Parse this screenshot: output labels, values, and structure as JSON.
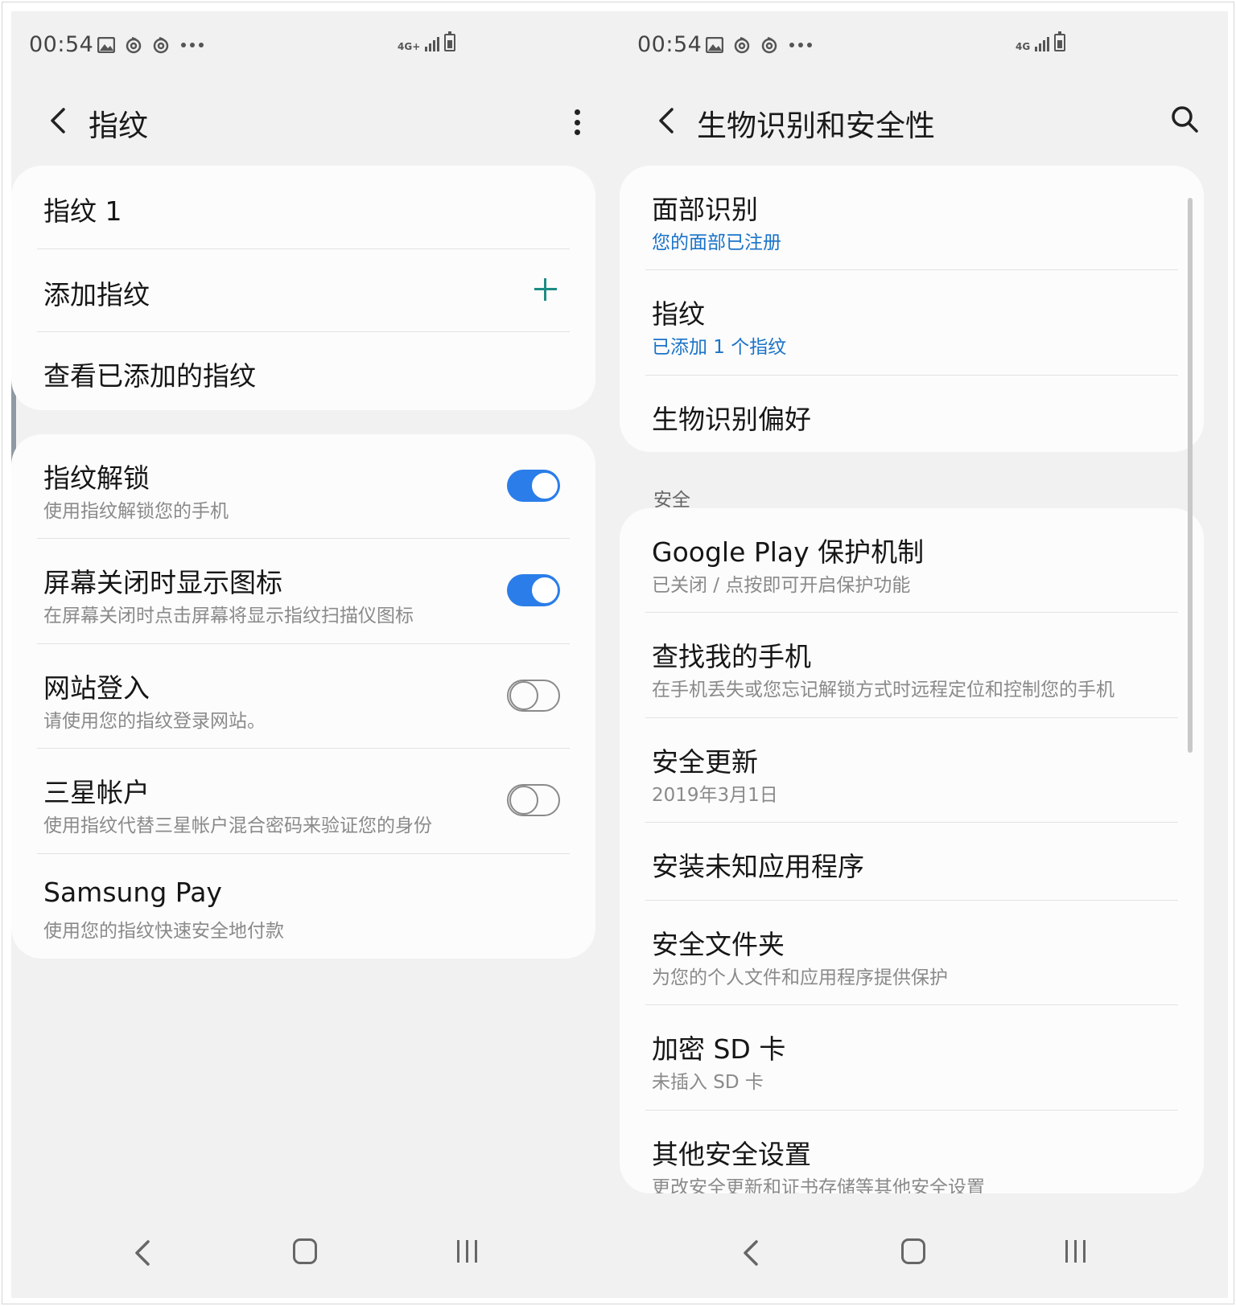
{
  "left": {
    "status": {
      "time": "00:54",
      "network": "4G+"
    },
    "appbar": {
      "title": "指纹"
    },
    "fingerprints_card": {
      "items": [
        {
          "label": "指纹 1"
        },
        {
          "label": "添加指纹"
        },
        {
          "label": "查看已添加的指纹"
        }
      ]
    },
    "options_card": {
      "items": [
        {
          "title": "指纹解锁",
          "subtitle": "使用指纹解锁您的手机",
          "toggle": "on"
        },
        {
          "title": "屏幕关闭时显示图标",
          "subtitle": "在屏幕关闭时点击屏幕将显示指纹扫描仪图标",
          "toggle": "on"
        },
        {
          "title": "网站登入",
          "subtitle": "请使用您的指纹登录网站。",
          "toggle": "off"
        },
        {
          "title": "三星帐户",
          "subtitle": "使用指纹代替三星帐户混合密码来验证您的身份",
          "toggle": "off"
        },
        {
          "title": "Samsung Pay",
          "subtitle": "使用您的指纹快速安全地付款"
        }
      ]
    }
  },
  "right": {
    "status": {
      "time": "00:54",
      "network": "4G"
    },
    "appbar": {
      "title": "生物识别和安全性"
    },
    "biometrics_card": {
      "items": [
        {
          "title": "面部识别",
          "subtitle": "您的面部已注册"
        },
        {
          "title": "指纹",
          "subtitle": "已添加 1 个指纹"
        },
        {
          "title": "生物识别偏好"
        }
      ]
    },
    "security_section_label": "安全",
    "security_card": {
      "items": [
        {
          "title": "Google Play 保护机制",
          "subtitle": "已关闭 / 点按即可开启保护功能"
        },
        {
          "title": "查找我的手机",
          "subtitle": "在手机丢失或您忘记解锁方式时远程定位和控制您的手机"
        },
        {
          "title": "安全更新",
          "subtitle": "2019年3月1日"
        },
        {
          "title": "安装未知应用程序"
        },
        {
          "title": "安全文件夹",
          "subtitle": "为您的个人文件和应用程序提供保护"
        },
        {
          "title": "加密 SD 卡",
          "subtitle": "未插入 SD 卡"
        },
        {
          "title": "其他安全设置",
          "subtitle": "更改安全更新和证书存储等其他安全设置"
        }
      ]
    }
  },
  "colors": {
    "accent_blue": "#2b7de9",
    "link_blue": "#1a73c8",
    "add_green": "#1d8c84",
    "background": "#f1f1f1",
    "card": "#fcfcfc"
  }
}
